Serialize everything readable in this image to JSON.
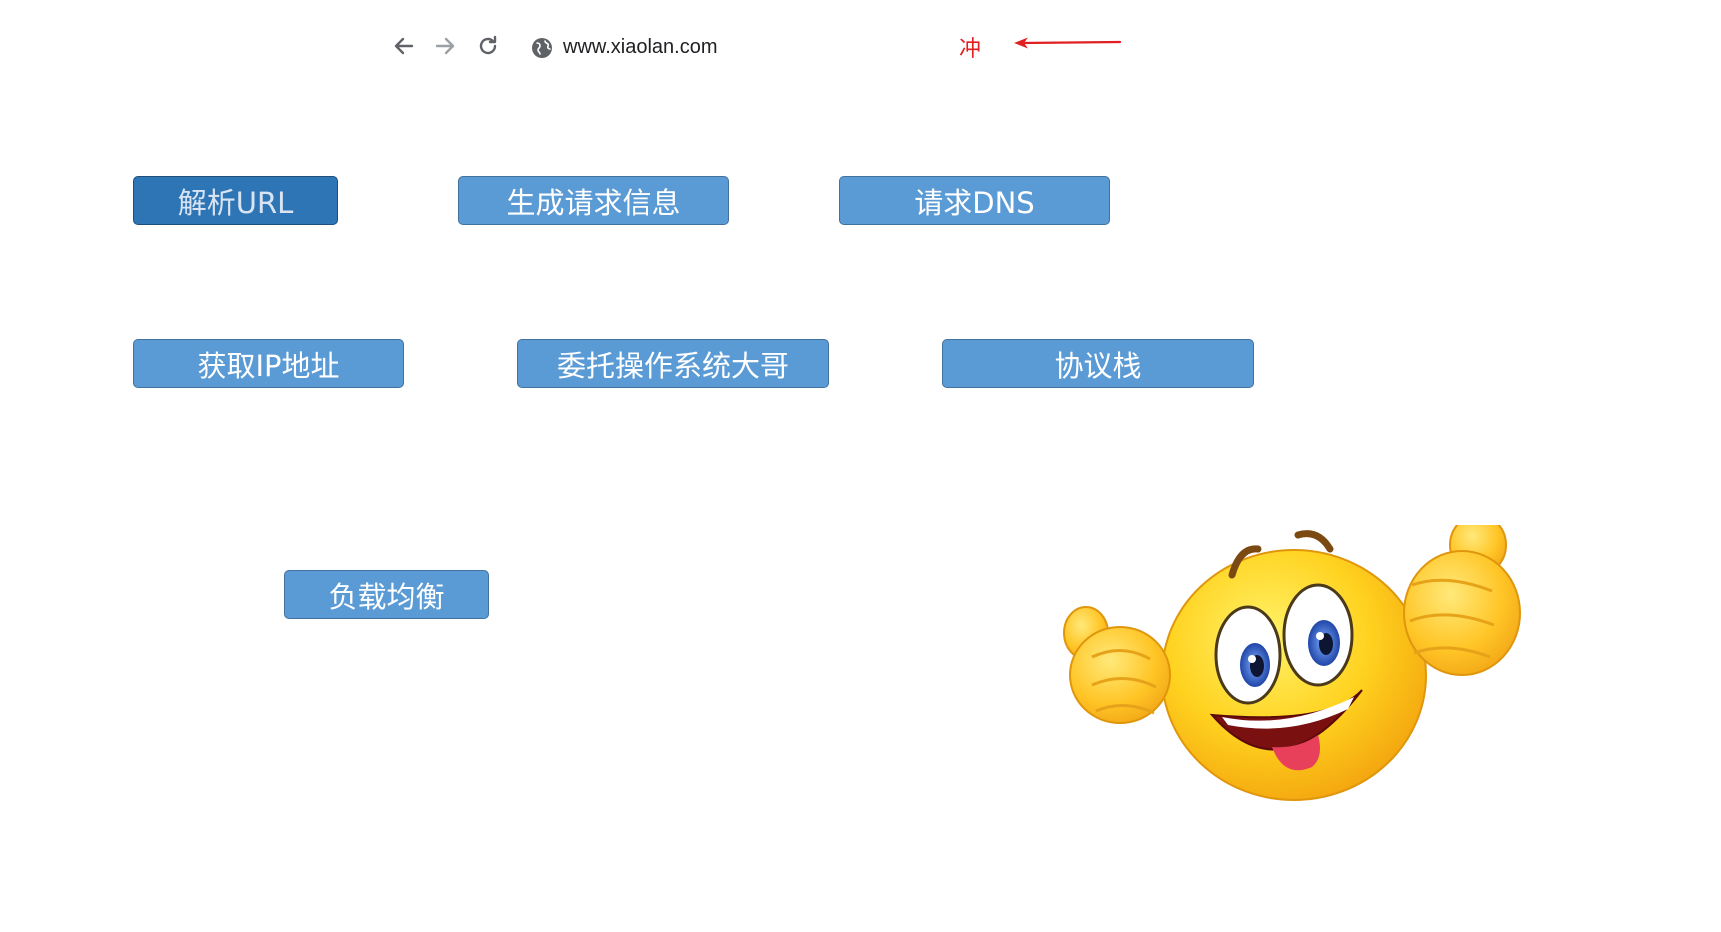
{
  "browser": {
    "url": "www.xiaolan.com",
    "back_icon": "arrow-left-icon",
    "forward_icon": "arrow-right-icon",
    "reload_icon": "reload-icon",
    "site_icon": "globe-icon"
  },
  "annotation": {
    "text": "冲",
    "color": "#e02020",
    "arrow_icon": "red-arrow-left-icon"
  },
  "steps": [
    {
      "label": "解析URL",
      "state": "active"
    },
    {
      "label": "生成请求信息",
      "state": "normal"
    },
    {
      "label": "请求DNS",
      "state": "normal"
    },
    {
      "label": "获取IP地址",
      "state": "normal"
    },
    {
      "label": "委托操作系统大哥",
      "state": "normal"
    },
    {
      "label": "协议栈",
      "state": "normal"
    },
    {
      "label": "负载均衡",
      "state": "normal"
    }
  ],
  "colors": {
    "step_fill": "#5b9bd5",
    "step_active_fill": "#2e75b6",
    "step_border": "#41719c"
  },
  "illustration": "thumbs-up-smiley-icon"
}
